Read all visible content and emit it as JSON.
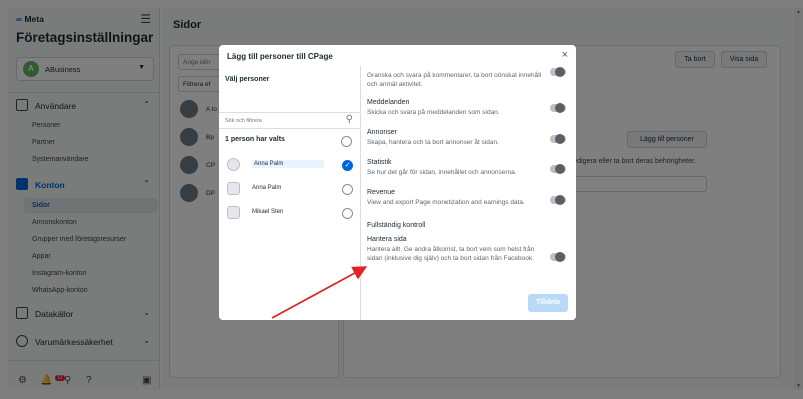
{
  "sidebar": {
    "brand": "Meta",
    "title": "Företagsinställningar",
    "account": {
      "avatar_letter": "A",
      "name": "ABusiness"
    },
    "sections": [
      {
        "label": "Användare",
        "items": [
          "Personer",
          "Partner",
          "Systemanvändare"
        ]
      },
      {
        "label": "Konton",
        "items": [
          "Sidor",
          "Annonskonton",
          "Grupper med företagsresurser",
          "Appar",
          "Instagram-konton",
          "WhatsApp-konton"
        ],
        "active": "Sidor"
      },
      {
        "label": "Datakällor"
      },
      {
        "label": "Varumärkessäkerhet"
      }
    ],
    "footer_badge": "12"
  },
  "main": {
    "title": "Sidor",
    "left_search_placeholder": "Ange id/n",
    "filter_label": "Filtrera ef",
    "pages": [
      "A lo",
      "Bp",
      "CP",
      "DP"
    ],
    "buttons": {
      "delete": "Ta bort",
      "view": "Visa sida",
      "add_people": "Lägg till personer"
    },
    "info_text": "redigera eller ta bort deras behörigheter."
  },
  "modal": {
    "title": "Lägg till personer till CPage",
    "select_people_label": "Välj personer",
    "search_placeholder": "Sök och filtrera",
    "selected_count": "1 person har valts",
    "people": [
      {
        "name": "Anna Palm",
        "selected": true
      },
      {
        "name": "Anna Palm",
        "selected": false
      },
      {
        "name": "Mikael Sten",
        "selected": false
      }
    ],
    "permissions": [
      {
        "title": "",
        "desc": "Granska och svara på kommentarer, ta bort oönskat innehåll och anmäl aktivitet."
      },
      {
        "title": "Meddelanden",
        "desc": "Skicka och svara på meddelanden som sidan."
      },
      {
        "title": "Annonser",
        "desc": "Skapa, hantera och ta bort annonser åt sidan."
      },
      {
        "title": "Statistik",
        "desc": "Se hur det går för sidan, innehållet och annonserna."
      },
      {
        "title": "Revenue",
        "desc": "View and export Page monetization and earnings data."
      }
    ],
    "full_control_label": "Fullständig kontroll",
    "manage": {
      "title": "Hantera sida",
      "desc": "Hantera allt. Ge andra åtkomst, ta bort vem som helst från sidan (inklusive dig själv) och ta bort sidan från Facebook."
    },
    "assign_button": "Tilldela"
  }
}
